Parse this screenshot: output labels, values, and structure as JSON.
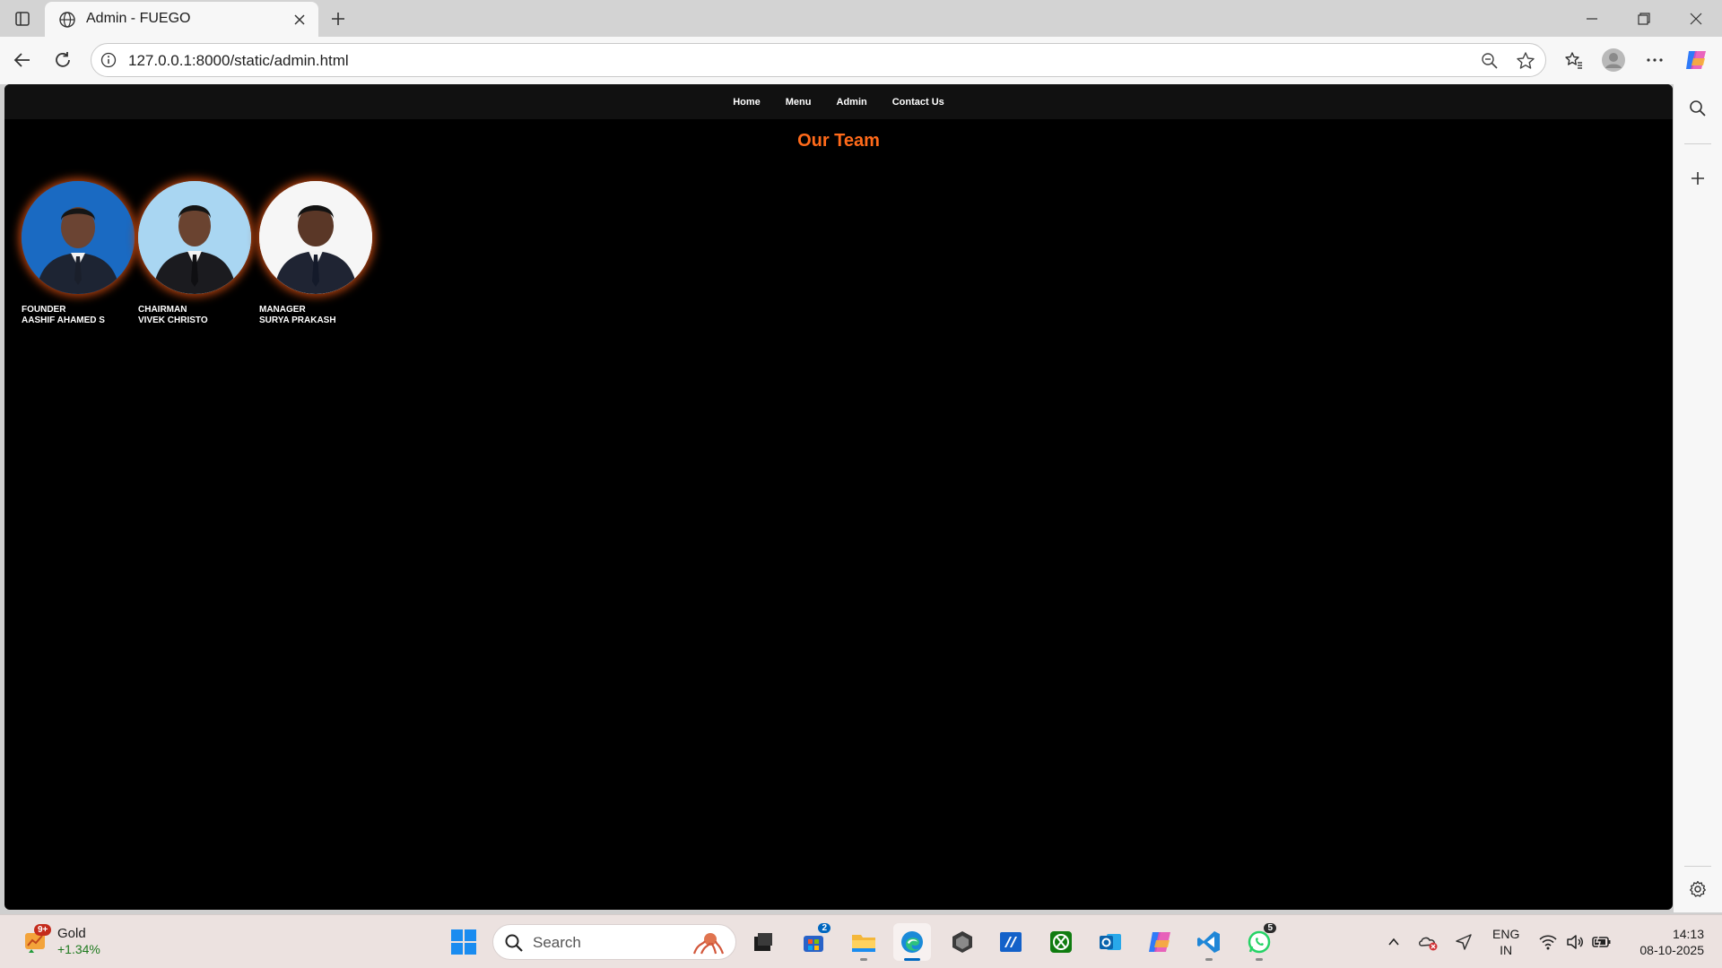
{
  "browser": {
    "tab_title": "Admin - FUEGO",
    "url": "127.0.0.1:8000/static/admin.html"
  },
  "site": {
    "nav": [
      "Home",
      "Menu",
      "Admin",
      "Contact Us"
    ],
    "heading": "Our Team",
    "members": [
      {
        "role": "FOUNDER",
        "name": "AASHIF AHAMED S"
      },
      {
        "role": "CHAIRMAN",
        "name": "VIVEK CHRISTO"
      },
      {
        "role": "MANAGER",
        "name": "SURYA PRAKASH"
      }
    ],
    "accent_color": "#ff6a1a"
  },
  "taskbar": {
    "widget": {
      "badge": "9+",
      "title": "Gold",
      "change": "+1.34%"
    },
    "search_placeholder": "Search",
    "store_badge": "2",
    "whatsapp_badge": "5",
    "language": [
      "ENG",
      "IN"
    ],
    "time": "14:13",
    "date": "08-10-2025"
  }
}
